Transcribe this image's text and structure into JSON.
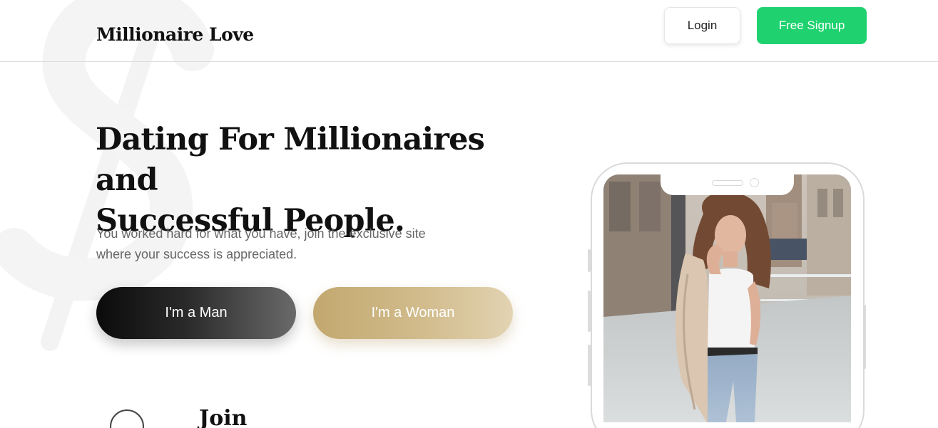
{
  "brand": {
    "name": "Millionaire Love"
  },
  "nav": {
    "login_label": "Login",
    "signup_label": "Free Signup"
  },
  "hero": {
    "headline_line1": "Dating For Millionaires and",
    "headline_line2": "Successful People.",
    "subtext_line1": "You worked hard for what you have, join the exclusive site",
    "subtext_line2": "where your success is appreciated.",
    "man_button": "I'm a Man",
    "woman_button": "I'm a Woman"
  },
  "steps": {
    "first_title": "Join"
  },
  "colors": {
    "signup_green": "#1fd26f",
    "gold": "#c9b07a",
    "dark": "#111111"
  },
  "icons": {
    "background": "dollar-sign-watermark",
    "phone": "smartphone-mockup"
  }
}
